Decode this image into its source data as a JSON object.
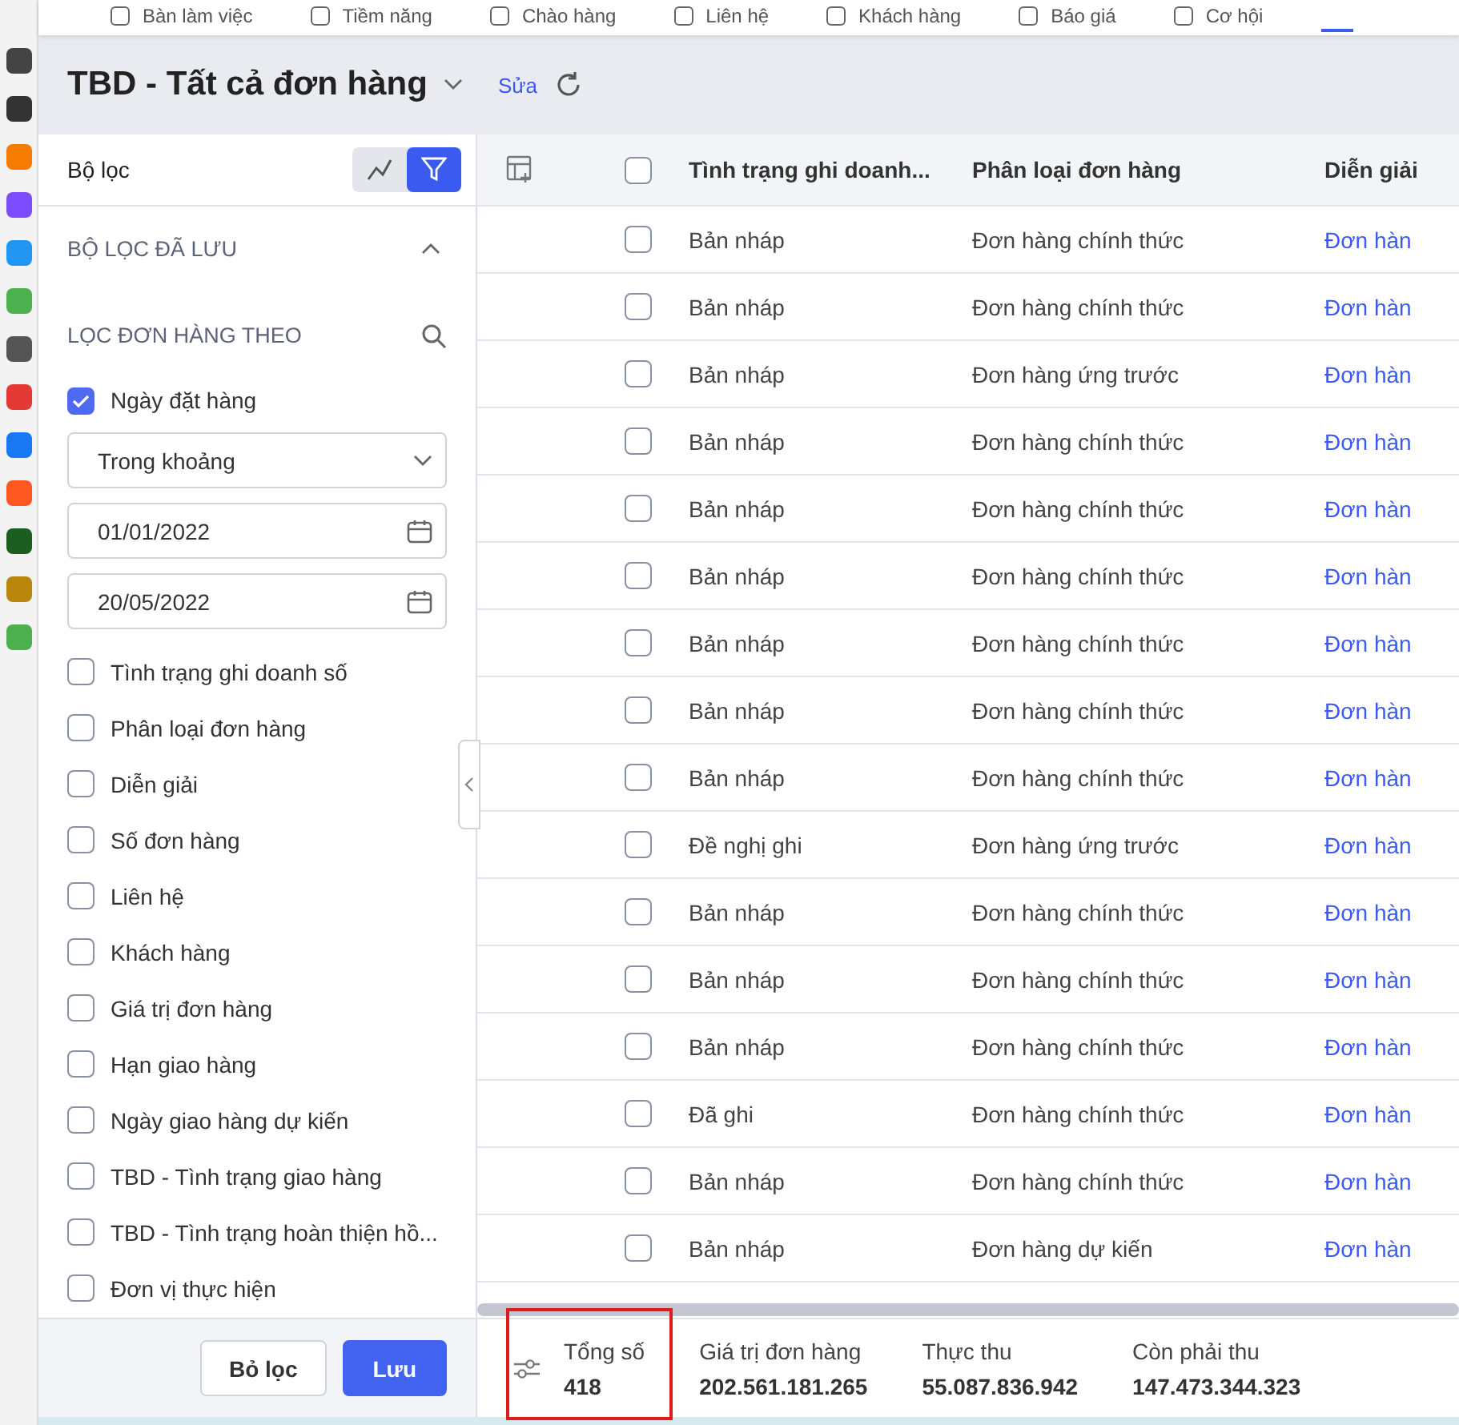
{
  "nav_tabs": [
    {
      "label": "Bàn làm việc",
      "selected": false
    },
    {
      "label": "Tiềm năng",
      "selected": false
    },
    {
      "label": "Chào hàng",
      "selected": false
    },
    {
      "label": "Liên hệ",
      "selected": false
    },
    {
      "label": "Khách hàng",
      "selected": false
    },
    {
      "label": "Báo giá",
      "selected": false
    },
    {
      "label": "Cơ hội",
      "selected": false
    },
    {
      "selected": true
    }
  ],
  "page": {
    "title": "TBD - Tất cả đơn hàng",
    "edit_link": "Sửa"
  },
  "filter_panel": {
    "title": "Bộ lọc",
    "saved_filters": {
      "label": "BỘ LỌC ĐÃ LƯU",
      "expanded": true
    },
    "filter_by": "LỌC ĐƠN HÀNG THEO",
    "criteria": [
      {
        "label": "Ngày đặt hàng",
        "checked": true,
        "condition": "Trong khoảng",
        "from": "01/01/2022",
        "to": "20/05/2022"
      },
      {
        "label": "Tình trạng ghi doanh số",
        "checked": false
      },
      {
        "label": "Phân loại đơn hàng",
        "checked": false
      },
      {
        "label": "Diễn giải",
        "checked": false
      },
      {
        "label": "Số đơn hàng",
        "checked": false
      },
      {
        "label": "Liên hệ",
        "checked": false
      },
      {
        "label": "Khách hàng",
        "checked": false
      },
      {
        "label": "Giá trị đơn hàng",
        "checked": false
      },
      {
        "label": "Hạn giao hàng",
        "checked": false
      },
      {
        "label": "Ngày giao hàng dự kiến",
        "checked": false
      },
      {
        "label": "TBD - Tình trạng giao hàng",
        "checked": false
      },
      {
        "label": "TBD - Tình trạng hoàn thiện hồ...",
        "checked": false
      },
      {
        "label": "Đơn vị thực hiện",
        "checked": false
      }
    ],
    "buttons": [
      "Bỏ lọc",
      "Lưu"
    ]
  },
  "table": {
    "all_selected": false,
    "columns": [
      "Tình trạng ghi doanh...",
      "Phân loại đơn hàng",
      "Diễn giải"
    ],
    "rows": [
      {
        "checked": false,
        "cells": [
          "Bản nháp",
          "Đơn hàng chính thức",
          "Đơn hàn"
        ]
      },
      {
        "checked": false,
        "cells": [
          "Bản nháp",
          "Đơn hàng chính thức",
          "Đơn hàn"
        ]
      },
      {
        "checked": false,
        "cells": [
          "Bản nháp",
          "Đơn hàng ứng trước",
          "Đơn hàn"
        ]
      },
      {
        "checked": false,
        "cells": [
          "Bản nháp",
          "Đơn hàng chính thức",
          "Đơn hàn"
        ]
      },
      {
        "checked": false,
        "cells": [
          "Bản nháp",
          "Đơn hàng chính thức",
          "Đơn hàn"
        ]
      },
      {
        "checked": false,
        "cells": [
          "Bản nháp",
          "Đơn hàng chính thức",
          "Đơn hàn"
        ]
      },
      {
        "checked": false,
        "cells": [
          "Bản nháp",
          "Đơn hàng chính thức",
          "Đơn hàn"
        ]
      },
      {
        "checked": false,
        "cells": [
          "Bản nháp",
          "Đơn hàng chính thức",
          "Đơn hàn"
        ]
      },
      {
        "checked": false,
        "cells": [
          "Bản nháp",
          "Đơn hàng chính thức",
          "Đơn hàn"
        ]
      },
      {
        "checked": false,
        "cells": [
          "Đề nghị ghi",
          "Đơn hàng ứng trước",
          "Đơn hàn"
        ]
      },
      {
        "checked": false,
        "cells": [
          "Bản nháp",
          "Đơn hàng chính thức",
          "Đơn hàn"
        ]
      },
      {
        "checked": false,
        "cells": [
          "Bản nháp",
          "Đơn hàng chính thức",
          "Đơn hàn"
        ]
      },
      {
        "checked": false,
        "cells": [
          "Bản nháp",
          "Đơn hàng chính thức",
          "Đơn hàn"
        ]
      },
      {
        "checked": false,
        "cells": [
          "Đã ghi",
          "Đơn hàng chính thức",
          "Đơn hàn"
        ]
      },
      {
        "checked": false,
        "cells": [
          "Bản nháp",
          "Đơn hàng chính thức",
          "Đơn hàn"
        ]
      },
      {
        "checked": false,
        "cells": [
          "Bản nháp",
          "Đơn hàng dự kiến",
          "Đơn hàn"
        ]
      }
    ]
  },
  "summary": [
    {
      "label": "Tổng số",
      "value": "418",
      "highlighted": true
    },
    {
      "label": "Giá trị đơn hàng",
      "value": "202.561.181.265",
      "highlighted": false
    },
    {
      "label": "Thực thu",
      "value": "55.087.836.942",
      "highlighted": false
    },
    {
      "label": "Còn phải thu",
      "value": "147.473.344.323",
      "highlighted": false
    }
  ]
}
